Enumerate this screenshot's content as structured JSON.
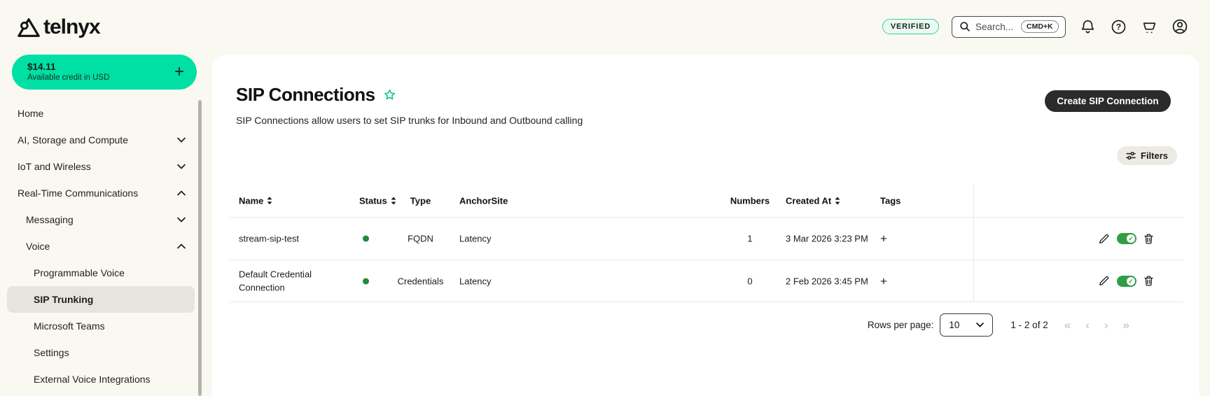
{
  "colors": {
    "accent_green": "#00E0A4",
    "status_active_dot": "#1F8A38",
    "toggle_on": "#2F9E44",
    "star_green": "#00C08B",
    "create_button_bg": "#2B2B2B",
    "page_background": "#FAF9F1"
  },
  "topbar": {
    "logo_text": "telnyx",
    "verified_label": "VERIFIED",
    "search_placeholder": "Search...",
    "search_shortcut": "CMD+K"
  },
  "sidebar": {
    "credit": {
      "amount": "$14.11",
      "label": "Available credit in USD",
      "add_symbol": "+"
    },
    "items": [
      {
        "label": "Home"
      },
      {
        "label": "AI, Storage and Compute"
      },
      {
        "label": "IoT and Wireless"
      },
      {
        "label": "Real-Time Communications"
      },
      {
        "label": "Messaging"
      },
      {
        "label": "Voice"
      },
      {
        "label": "Programmable Voice"
      },
      {
        "label": "SIP Trunking"
      },
      {
        "label": "Microsoft Teams"
      },
      {
        "label": "Settings"
      },
      {
        "label": "External Voice Integrations"
      }
    ]
  },
  "main": {
    "title": "SIP Connections",
    "subtitle": "SIP Connections allow users to set SIP trunks for Inbound and Outbound calling",
    "create_button_label": "Create SIP Connection",
    "filters_label": "Filters",
    "table": {
      "headers": [
        "Name",
        "Status",
        "Type",
        "AnchorSite",
        "Numbers",
        "Created At",
        "Tags"
      ],
      "rows": [
        {
          "name": "stream-sip-test",
          "status": "active",
          "type": "FQDN",
          "anchorsite": "Latency",
          "numbers": "1",
          "created_at": "3 Mar 2026 3:23 PM",
          "add_tag": "+"
        },
        {
          "name": "Default Credential Connection",
          "status": "active",
          "type": "Credentials",
          "anchorsite": "Latency",
          "numbers": "0",
          "created_at": "2 Feb 2026 3:45 PM",
          "add_tag": "+"
        }
      ]
    },
    "pagination": {
      "rows_per_page_label": "Rows per page:",
      "rows_per_page_value": "10",
      "range_label": "1 - 2 of 2",
      "first": "«",
      "prev": "‹",
      "next": "›",
      "last": "»"
    }
  }
}
